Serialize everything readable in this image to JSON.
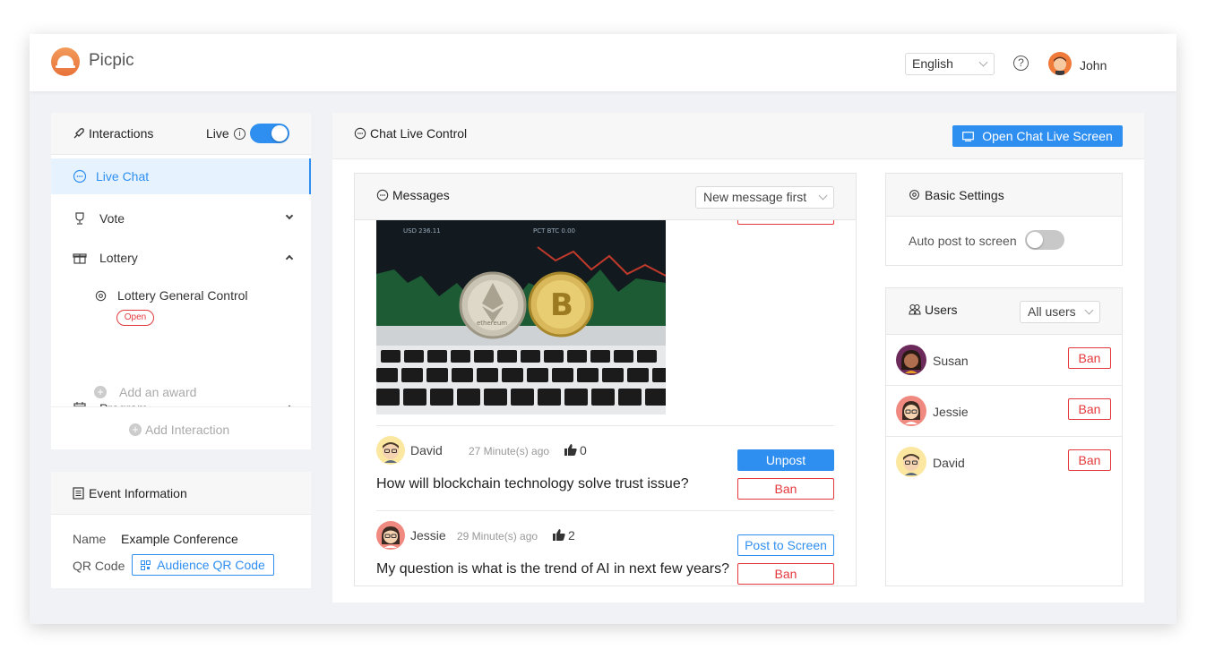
{
  "header": {
    "brand": "Picpic",
    "language": "English",
    "help_glyph": "?",
    "user": "John"
  },
  "sidebar": {
    "title": "Interactions",
    "live_label": "Live",
    "live_info": "i",
    "live_on": true,
    "items": [
      {
        "label": "Live Chat",
        "icon": "chat-icon",
        "active": true
      },
      {
        "label": "Vote",
        "icon": "trophy-icon",
        "expanded": false
      },
      {
        "label": "Lottery",
        "icon": "gift-icon",
        "expanded": true
      },
      {
        "label": "Program",
        "icon": "calendar-icon",
        "expanded": true
      }
    ],
    "lottery_sub": {
      "label": "Lottery General Control",
      "badge": "Open"
    },
    "add_award": "Add an award",
    "add_interaction": "Add Interaction"
  },
  "event": {
    "title": "Event Information",
    "name_label": "Name",
    "name_value": "Example Conference",
    "qr_label": "QR Code",
    "qr_button": "Audience QR Code"
  },
  "main": {
    "title": "Chat Live Control",
    "open_screen_button": "Open Chat Live Screen"
  },
  "messages": {
    "title": "Messages",
    "sort": "New message first",
    "items": [
      {
        "user": "David",
        "time": "27 Minute(s) ago",
        "likes": "0",
        "text": "How will blockchain technology solve trust issue?",
        "action": "Unpost",
        "ban": "Ban"
      },
      {
        "user": "Jessie",
        "time": "29 Minute(s) ago",
        "likes": "2",
        "text": "My question is what is the trend of AI in next few years?",
        "action": "Post to Screen",
        "ban": "Ban"
      }
    ]
  },
  "settings": {
    "title": "Basic Settings",
    "auto_post_label": "Auto post to screen",
    "auto_post_on": false
  },
  "users": {
    "title": "Users",
    "filter": "All users",
    "list": [
      {
        "name": "Susan",
        "ban": "Ban"
      },
      {
        "name": "Jessie",
        "ban": "Ban"
      },
      {
        "name": "David",
        "ban": "Ban"
      }
    ]
  },
  "image": {
    "coin_left_text": "ethereum",
    "chart_label_1": "USD 236.11",
    "chart_label_2": "PCT BTC 0.00"
  },
  "colors": {
    "accent": "#2f8ff0",
    "danger": "#e4393c",
    "active_bg": "#e6f3ff"
  }
}
